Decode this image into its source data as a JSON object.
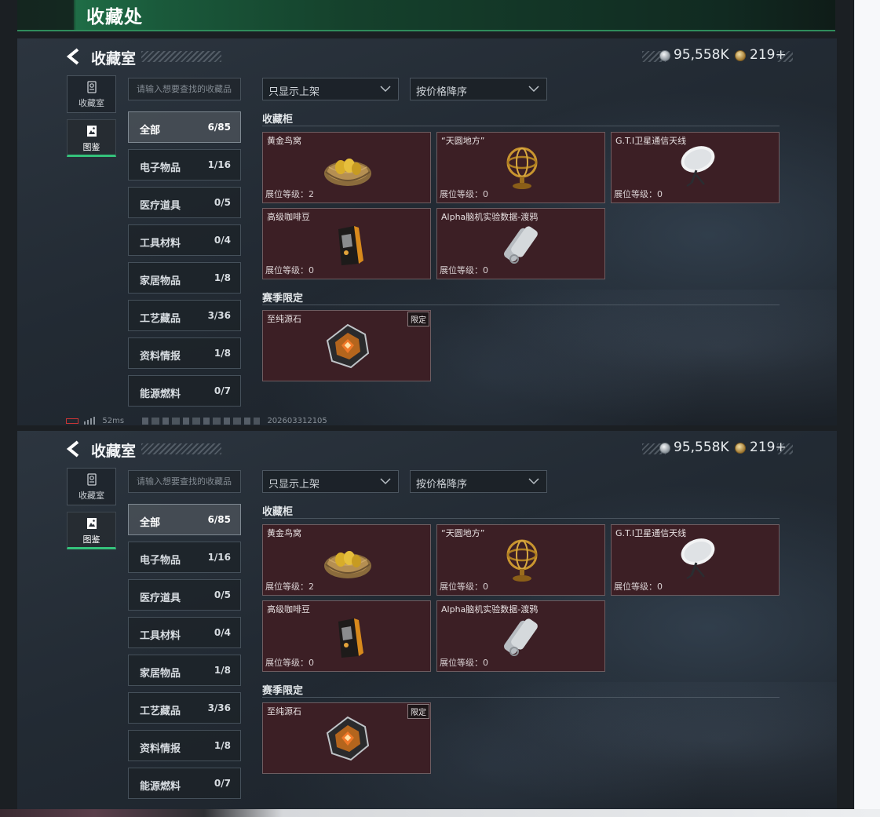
{
  "banner": {
    "title": "收藏处"
  },
  "panels": [
    {
      "title": "收藏室",
      "currency": {
        "silver": "95,558K",
        "gold": "219+"
      },
      "side_tabs": [
        {
          "label": "收藏室"
        },
        {
          "label": "图鉴"
        }
      ],
      "search_placeholder": "请输入想要查找的收藏品",
      "filters": {
        "shelf": "只显示上架",
        "sort": "按价格降序"
      },
      "categories": [
        {
          "label": "全部",
          "count": "6/85"
        },
        {
          "label": "电子物品",
          "count": "1/16"
        },
        {
          "label": "医疗道具",
          "count": "0/5"
        },
        {
          "label": "工具材料",
          "count": "0/4"
        },
        {
          "label": "家居物品",
          "count": "1/8"
        },
        {
          "label": "工艺藏品",
          "count": "3/36"
        },
        {
          "label": "资料情报",
          "count": "1/8"
        },
        {
          "label": "能源燃料",
          "count": "0/7"
        }
      ],
      "sections": {
        "cabinet": "收藏柜",
        "season": "赛季限定"
      },
      "items": [
        {
          "name": "黄金鸟窝",
          "level": "展位等级：2"
        },
        {
          "name": "“天圆地方”",
          "level": "展位等级：0"
        },
        {
          "name": "G.T.I卫星通信天线",
          "level": "展位等级：0"
        },
        {
          "name": "高级咖啡豆",
          "level": "展位等级：0"
        },
        {
          "name": "Alpha脑机实验数据-渡鸦",
          "level": "展位等级：0"
        }
      ],
      "season_items": [
        {
          "name": "至纯源石",
          "badge": "限定"
        }
      ],
      "status": {
        "ping": "52ms",
        "build": "202603312105"
      }
    },
    {
      "title": "收藏室",
      "currency": {
        "silver": "95,558K",
        "gold": "219+"
      },
      "side_tabs": [
        {
          "label": "收藏室"
        },
        {
          "label": "图鉴"
        }
      ],
      "search_placeholder": "请输入想要查找的收藏品",
      "filters": {
        "shelf": "只显示上架",
        "sort": "按价格降序"
      },
      "categories": [
        {
          "label": "全部",
          "count": "6/85"
        },
        {
          "label": "电子物品",
          "count": "1/16"
        },
        {
          "label": "医疗道具",
          "count": "0/5"
        },
        {
          "label": "工具材料",
          "count": "0/4"
        },
        {
          "label": "家居物品",
          "count": "1/8"
        },
        {
          "label": "工艺藏品",
          "count": "3/36"
        },
        {
          "label": "资料情报",
          "count": "1/8"
        },
        {
          "label": "能源燃料",
          "count": "0/7"
        }
      ],
      "sections": {
        "cabinet": "收藏柜",
        "season": "赛季限定"
      },
      "items": [
        {
          "name": "黄金鸟窝",
          "level": "展位等级：2"
        },
        {
          "name": "“天圆地方”",
          "level": "展位等级：0"
        },
        {
          "name": "G.T.I卫星通信天线",
          "level": "展位等级：0"
        },
        {
          "name": "高级咖啡豆",
          "level": "展位等级：0"
        },
        {
          "name": "Alpha脑机实验数据-渡鸦",
          "level": "展位等级：0"
        }
      ],
      "season_items": [
        {
          "name": "至纯源石",
          "badge": "限定"
        }
      ]
    }
  ],
  "icons": {
    "back": "back-chevron-icon",
    "silver_coin": "silver-coin-icon",
    "gold_coin": "gold-coin-icon",
    "collection_room": "trophy-icon",
    "codex": "picture-book-icon",
    "dropdown": "chevron-down-icon"
  },
  "colors": {
    "accent": "#34c27b",
    "card_bg": "#3c1f25"
  }
}
